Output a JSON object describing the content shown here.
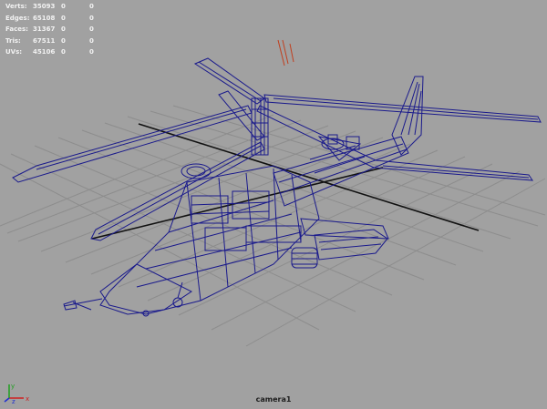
{
  "hud": {
    "rows": [
      {
        "label": "Verts:",
        "v1": "35093",
        "v2": "0",
        "v3": "0"
      },
      {
        "label": "Edges:",
        "v1": "65108",
        "v2": "0",
        "v3": "0"
      },
      {
        "label": "Faces:",
        "v1": "31367",
        "v2": "0",
        "v3": "0"
      },
      {
        "label": "Tris:",
        "v1": "67511",
        "v2": "0",
        "v3": "0"
      },
      {
        "label": "UVs:",
        "v1": "45106",
        "v2": "0",
        "v3": "0"
      }
    ]
  },
  "viewport": {
    "camera_label": "camera1",
    "background_color": "#a1a1a1",
    "grid_color": "#8a8a8a",
    "axis_line_color": "#111111",
    "wireframe_color": "#1a1a8c"
  },
  "axis_gizmo": {
    "x": "x",
    "y": "y",
    "z": "z"
  }
}
